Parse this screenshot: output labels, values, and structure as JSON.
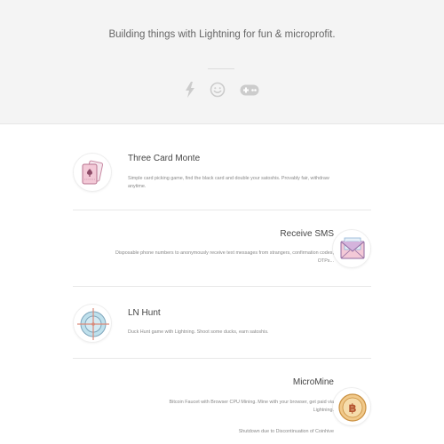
{
  "hero": {
    "tagline": "Building things with Lightning for fun & microprofit.",
    "icons": [
      "lightning-icon",
      "smiley-icon",
      "gamepad-icon"
    ]
  },
  "projects": [
    {
      "title": "Three Card Monte",
      "description": "Simple card picking game, find the black card and double your satoshis. Provably fair, withdraw anytime.",
      "icon": "playing-cards-icon"
    },
    {
      "title": "Receive SMS",
      "description": "Disposable phone numbers to anonymously receive text messages from strangers, confirmation codes, OTPs...",
      "icon": "envelope-icon"
    },
    {
      "title": "LN Hunt",
      "description": "Duck Hunt game with Lightning. Shoot some ducks, earn satoshis.",
      "icon": "crosshair-icon"
    },
    {
      "title": "MicroMine",
      "description": "Bitcoin Faucet with Browser CPU Mining. Mine with your browser, get paid via Lightning.",
      "note": "Shutdown due to Discontinuation of Coinhive",
      "icon": "bitcoin-coin-icon"
    }
  ],
  "colors": {
    "hero_bg": "#f4f4f4",
    "icon_gray": "#cccccc",
    "accent_pink": "#e9a0b6",
    "accent_blue": "#8fb3d6",
    "accent_gold": "#e2b76a"
  }
}
